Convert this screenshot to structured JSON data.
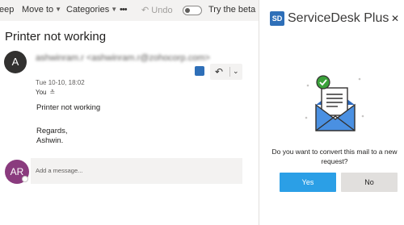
{
  "toolbar": {
    "item0": "eep",
    "move_to": "Move to",
    "categories": "Categories",
    "more": "•••",
    "undo": "Undo",
    "beta_label": "Try the beta"
  },
  "message": {
    "subject": "Printer not working",
    "avatar_initial": "A",
    "sender": "ashwinram.r <ashwinram.r@zohocorp.com>",
    "date": "Tue 10-10, 18:02",
    "to_label": "You",
    "body_lines": [
      "Printer not working",
      "Regards,",
      "Ashwin."
    ]
  },
  "reply": {
    "avatar_initials": "AR",
    "placeholder": "Add a message..."
  },
  "panel": {
    "logo_text": "SD",
    "title": "ServiceDesk Plus",
    "close_glyph": "✕",
    "question": "Do you want to convert this mail to a new request?",
    "yes_label": "Yes",
    "no_label": "No"
  },
  "colors": {
    "accent": "#2b9fe6",
    "brand": "#2e6fb8",
    "check": "#3aa13a",
    "avatar_reply": "#8a3b7e"
  },
  "icons": [
    "chevron-down-icon",
    "more-icon",
    "undo-icon",
    "toggle-switch",
    "reply-icon",
    "envelope-illustration",
    "check-icon",
    "close-icon"
  ]
}
